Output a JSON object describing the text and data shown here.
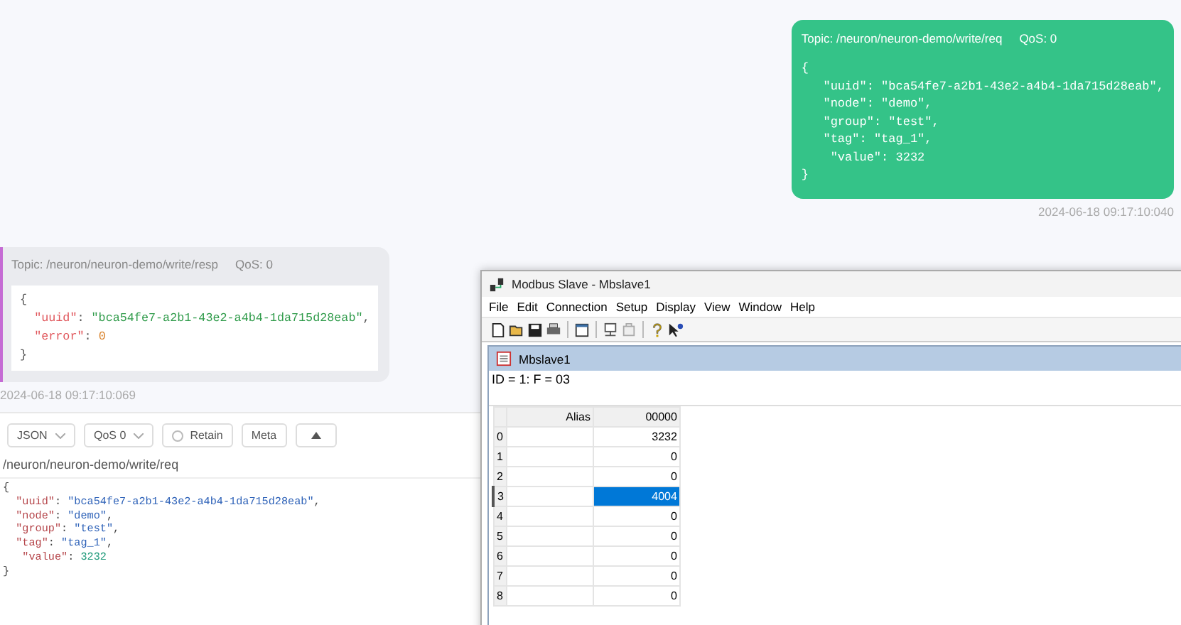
{
  "mqtt": {
    "messages": [
      {
        "kind": "outgoing",
        "topic": "Topic: /neuron/neuron-demo/write/req",
        "qos": "QoS: 0",
        "payload": [
          "{",
          "   \"uuid\": \"bca54fe7-a2b1-43e2-a4b4-1da715d28eab\",",
          "   \"node\": \"demo\",",
          "   \"group\": \"test\",",
          "   \"tag\": \"tag_1\",",
          "    \"value\": 3232",
          "}"
        ],
        "time": "2024-06-18 09:17:10:040"
      },
      {
        "kind": "incoming",
        "topic": "Topic: /neuron/neuron-demo/write/resp",
        "qos": "QoS: 0",
        "payload": [
          "{",
          "  \"uuid\": \"bca54fe7-a2b1-43e2-a4b4-1da715d28eab\",",
          "  \"error\": 0",
          "}"
        ],
        "time": "2024-06-18 09:17:10:069"
      }
    ],
    "composer": {
      "format": "JSON",
      "qos": "QoS 0",
      "retain": {
        "label": "Retain",
        "checked": false
      },
      "meta": "Meta",
      "topic": "/neuron/neuron-demo/write/req",
      "payload": [
        "{",
        "  \"uuid\": \"bca54fe7-a2b1-43e2-a4b4-1da715d28eab\",",
        "  \"node\": \"demo\",",
        "  \"group\": \"test\",",
        "  \"tag\": \"tag_1\",",
        "   \"value\": 3232",
        "}"
      ]
    }
  },
  "modbus_window": {
    "title": "Modbus Slave - Mbslave1",
    "menu": [
      "File",
      "Edit",
      "Connection",
      "Setup",
      "Display",
      "View",
      "Window",
      "Help"
    ],
    "child": {
      "title": "Mbslave1",
      "header": "ID = 1: F = 03",
      "columns": [
        "Alias",
        "00000"
      ],
      "rows": [
        {
          "index": "0",
          "value": "3232",
          "selected": false
        },
        {
          "index": "1",
          "value": "0",
          "selected": false
        },
        {
          "index": "2",
          "value": "0",
          "selected": false
        },
        {
          "index": "3",
          "value": "4004",
          "selected": true
        },
        {
          "index": "4",
          "value": "0",
          "selected": false
        },
        {
          "index": "5",
          "value": "0",
          "selected": false
        },
        {
          "index": "6",
          "value": "0",
          "selected": false
        },
        {
          "index": "7",
          "value": "0",
          "selected": false
        },
        {
          "index": "8",
          "value": "0",
          "selected": false
        }
      ]
    }
  }
}
